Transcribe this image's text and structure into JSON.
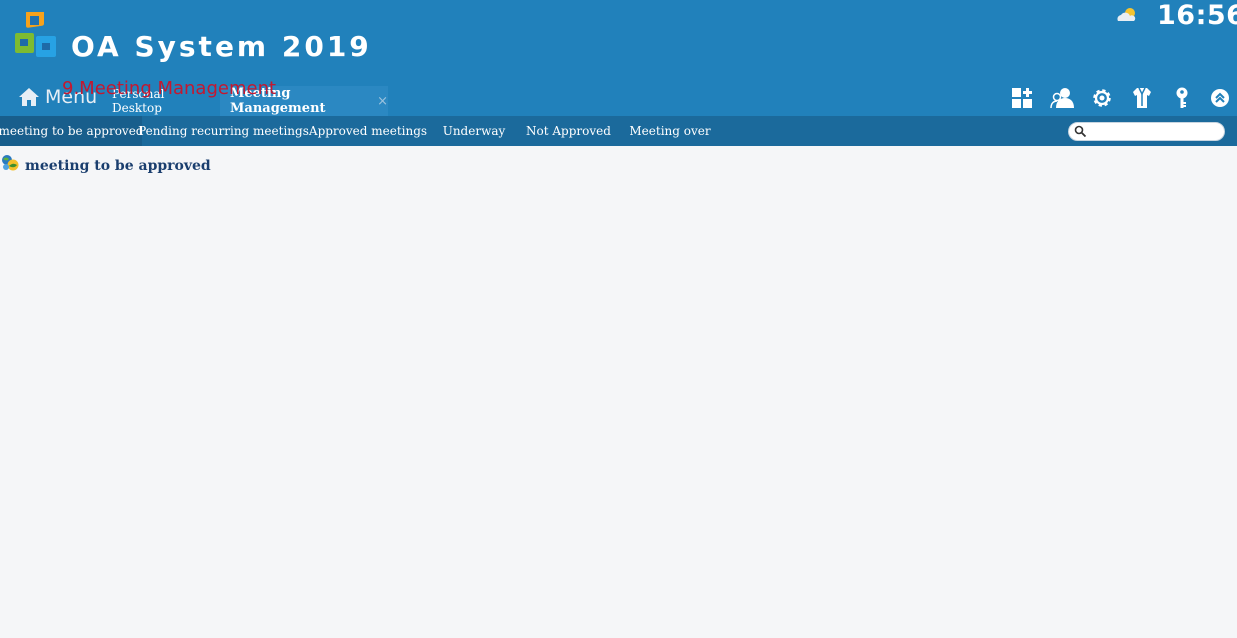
{
  "header": {
    "app_title": "OA System 2019",
    "clock": "16:56",
    "menu_label": "Menu",
    "overlay_title": "9.Meeting Management"
  },
  "tabs": [
    {
      "label": "Personal Desktop",
      "active": false
    },
    {
      "label": "Meeting Management",
      "active": true,
      "close": "×"
    }
  ],
  "toolbar_icons": [
    "add-widget-icon",
    "users-icon",
    "settings-gear-icon",
    "shirt-skin-icon",
    "key-icon",
    "collapse-up-icon"
  ],
  "subnav": {
    "items": [
      {
        "label": "meeting to be approved",
        "active": true
      },
      {
        "label": "Pending recurring meetings",
        "active": false
      },
      {
        "label": "Approved meetings",
        "active": false
      },
      {
        "label": "Underway",
        "active": false
      },
      {
        "label": "Not Approved",
        "active": false
      },
      {
        "label": "Meeting over",
        "active": false
      }
    ],
    "search_value": ""
  },
  "content": {
    "section_title": "meeting to be approved"
  },
  "colors": {
    "header_bg": "#2181bb",
    "subnav_bg": "#1b6a9c",
    "active_subnav_bg": "#185e8c",
    "overlay_title": "#c41830",
    "section_title": "#1a3e6e",
    "page_bg": "#f5f6f8"
  }
}
